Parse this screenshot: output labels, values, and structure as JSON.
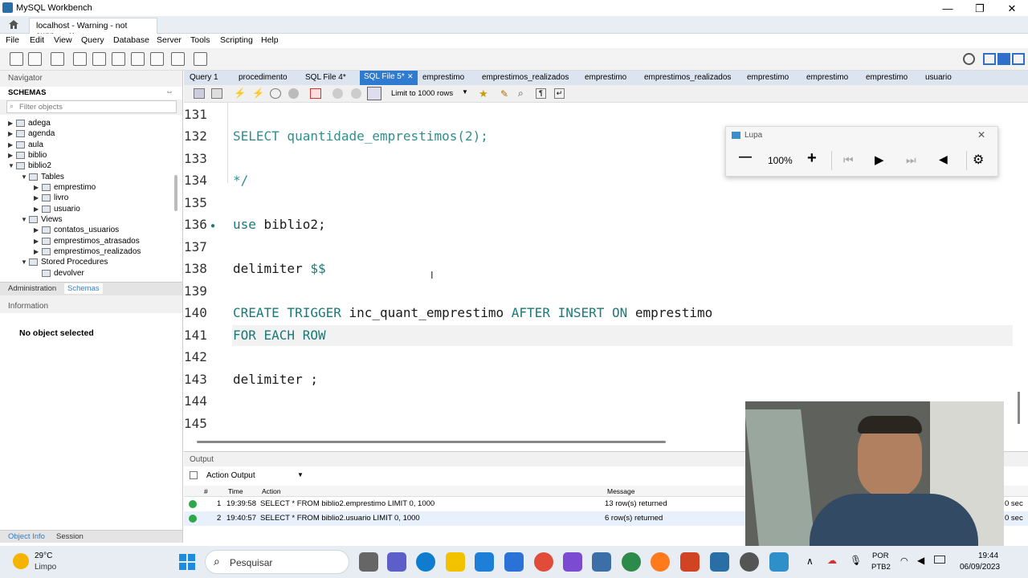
{
  "window": {
    "title": "MySQL Workbench",
    "minimize": "—",
    "maximize": "❐",
    "close": "✕"
  },
  "connection_tab": {
    "label": "localhost - Warning - not supp...",
    "close": "✕"
  },
  "menu": [
    "File",
    "Edit",
    "View",
    "Query",
    "Database",
    "Server",
    "Tools",
    "Scripting",
    "Help"
  ],
  "navigator": {
    "title": "Navigator",
    "schemas_title": "SCHEMAS",
    "filter_placeholder": "Filter objects",
    "schemas": [
      "adega",
      "agenda",
      "aula",
      "biblio",
      "biblio2"
    ],
    "tables_label": "Tables",
    "tables": [
      "emprestimo",
      "livro",
      "usuario"
    ],
    "views_label": "Views",
    "views": [
      "contatos_usuarios",
      "emprestimos_atrasados",
      "emprestimos_realizados"
    ],
    "procedures_label": "Stored Procedures",
    "procedures": [
      "devolver"
    ],
    "tab_admin": "Administration",
    "tab_schemas": "Schemas",
    "info_title": "Information",
    "info_text": "No object selected",
    "tab_objinfo": "Object Info",
    "tab_session": "Session"
  },
  "query_tabs": [
    "Query 1",
    "procedimento",
    "SQL File 4*",
    "SQL File 5*",
    "emprestimo",
    "emprestimos_realizados",
    "emprestimo",
    "emprestimos_realizados",
    "emprestimo",
    "emprestimo",
    "emprestimo",
    "usuario"
  ],
  "active_tab_index": 3,
  "limit_select": "Limit to 1000 rows",
  "editor": {
    "lines": [
      {
        "num": "131",
        "code": ""
      },
      {
        "num": "132",
        "code": "SELECT quantidade_emprestimos(2);"
      },
      {
        "num": "133",
        "code": ""
      },
      {
        "num": "134",
        "code": "*/"
      },
      {
        "num": "135",
        "code": ""
      },
      {
        "num": "136",
        "code": "use biblio2;"
      },
      {
        "num": "137",
        "code": ""
      },
      {
        "num": "138",
        "code": "delimiter $$"
      },
      {
        "num": "139",
        "code": ""
      },
      {
        "num": "140",
        "code": "CREATE TRIGGER inc_quant_emprestimo AFTER INSERT ON emprestimo"
      },
      {
        "num": "141",
        "code": "FOR EACH ROW"
      },
      {
        "num": "142",
        "code": ""
      },
      {
        "num": "143",
        "code": "delimiter ;"
      },
      {
        "num": "144",
        "code": ""
      },
      {
        "num": "145",
        "code": ""
      }
    ]
  },
  "lupa": {
    "title": "Lupa",
    "zoom": "100%",
    "minus": "—",
    "plus": "+"
  },
  "output": {
    "title": "Output",
    "select": "Action Output",
    "headers": {
      "num": "#",
      "time": "Time",
      "action": "Action",
      "message": "Message"
    },
    "rows": [
      {
        "num": "1",
        "time": "19:39:58",
        "action": "SELECT * FROM biblio2.emprestimo LIMIT 0, 1000",
        "message": "13 row(s) returned",
        "tail": "0 sec"
      },
      {
        "num": "2",
        "time": "19:40:57",
        "action": "SELECT * FROM biblio2.usuario LIMIT 0, 1000",
        "message": "6 row(s) returned",
        "tail": "0 sec"
      }
    ]
  },
  "taskbar": {
    "weather_temp": "29°C",
    "weather_desc": "Limpo",
    "search_placeholder": "Pesquisar",
    "lang1": "POR",
    "lang2": "PTB2",
    "time": "19:44",
    "date": "06/09/2023"
  },
  "colors": {
    "keyword": "#1a7a7a",
    "comment": "#2f8f8f",
    "active_tab": "#2f7bd0",
    "ok_status": "#2ea84a"
  }
}
